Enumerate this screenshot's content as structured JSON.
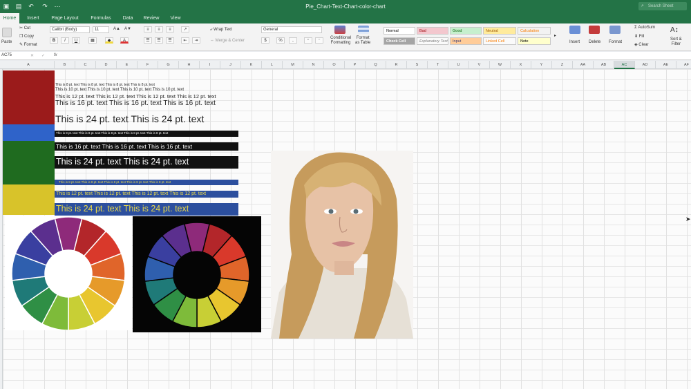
{
  "window": {
    "title": "Pie_Chart-Text-Chart-color-chart",
    "search_placeholder": "Search Sheet"
  },
  "tabs": [
    "Home",
    "Insert",
    "Page Layout",
    "Formulas",
    "Data",
    "Review",
    "View"
  ],
  "ribbon": {
    "paste": "Paste",
    "cut": "Cut",
    "copy": "Copy",
    "format_painter": "Format",
    "font_name": "Calibri (Body)",
    "font_size": "11",
    "bold": "B",
    "italic": "I",
    "underline": "U",
    "wrap_text": "Wrap Text",
    "merge_center": "Merge & Center",
    "number_format": "General",
    "currency": "$",
    "percent": "%",
    "conditional_formatting": [
      "Conditional",
      "Formatting"
    ],
    "format_as_table": [
      "Format",
      "as Table"
    ],
    "styles": {
      "normal": "Normal",
      "bad": "Bad",
      "good": "Good",
      "neutral": "Neutral",
      "calculation": "Calculation",
      "check_cell": "Check Cell",
      "explanatory": "Explanatory Text",
      "input": "Input",
      "linked_cell": "Linked Cell",
      "note": "Note"
    },
    "insert": "Insert",
    "delete": "Delete",
    "format": "Format",
    "autosum": "AutoSum",
    "fill": "Fill",
    "clear": "Clear",
    "sort_filter": [
      "Sort &",
      "Filter"
    ]
  },
  "formula_bar": {
    "name_box": "AC75",
    "fx": "fx",
    "content": ""
  },
  "columns": [
    "A",
    "B",
    "C",
    "D",
    "E",
    "F",
    "G",
    "H",
    "I",
    "J",
    "K",
    "L",
    "M",
    "N",
    "O",
    "P",
    "Q",
    "R",
    "S",
    "T",
    "U",
    "V",
    "W",
    "X",
    "Y",
    "Z",
    "AA",
    "AB",
    "AC",
    "AD",
    "AE",
    "AF"
  ],
  "selected_column": "AC",
  "colors": {
    "excel_green": "#237346",
    "swatch_red": "#9b1b1b",
    "swatch_blue": "#2f63c9",
    "swatch_green": "#1f6b1f",
    "swatch_yellow": "#d8c32a",
    "bar_black": "#111111",
    "bar_blue": "#2c4f9e"
  },
  "sheet_text": {
    "r8": "This is 8 pt. text   This is 8 pt. text   This is 8 pt. text   This is 8 pt. text",
    "r10": "This is 10 pt. text   This is 10 pt. text   This is 10 pt. text   This is 10 pt. text",
    "r12": "This is 12 pt. text   This is 12 pt. text   This is 12 pt. text   This is 12 pt. text",
    "r16": "This is 16 pt. text   This is 16 pt. text   This is 16 pt. text",
    "r24": "This is 24 pt. text   This is 24 pt. text",
    "bk8": "This is 8 pt. text   This is 8 pt. text   This is 8 pt. text   This is 8 pt. text   This is 8 pt. text",
    "bk16": "This is 16 pt. text   This is 16 pt. text   This is 16 pt. text",
    "bk24": "This is 24 pt. text   This is 24 pt. text",
    "bl8": "This is 8 pt. text   This is 8 pt. text   This is 8 pt. text   This is 8 pt. text   This is 8 pt. text",
    "bl12": "This is 12 pt. text   This is 12 pt. text   This is 12 pt. text   This is 12 pt. text",
    "bl24": "This is 24 pt. text   This is 24 pt. text"
  },
  "color_wheel_segments": [
    "#8e2a7a",
    "#b3262a",
    "#d9392b",
    "#e0652a",
    "#e69a2a",
    "#e8c62f",
    "#c8cf35",
    "#7ebb3a",
    "#2f8f45",
    "#1f7a78",
    "#2f5fae",
    "#3a3fa0",
    "#5b2f8e"
  ]
}
